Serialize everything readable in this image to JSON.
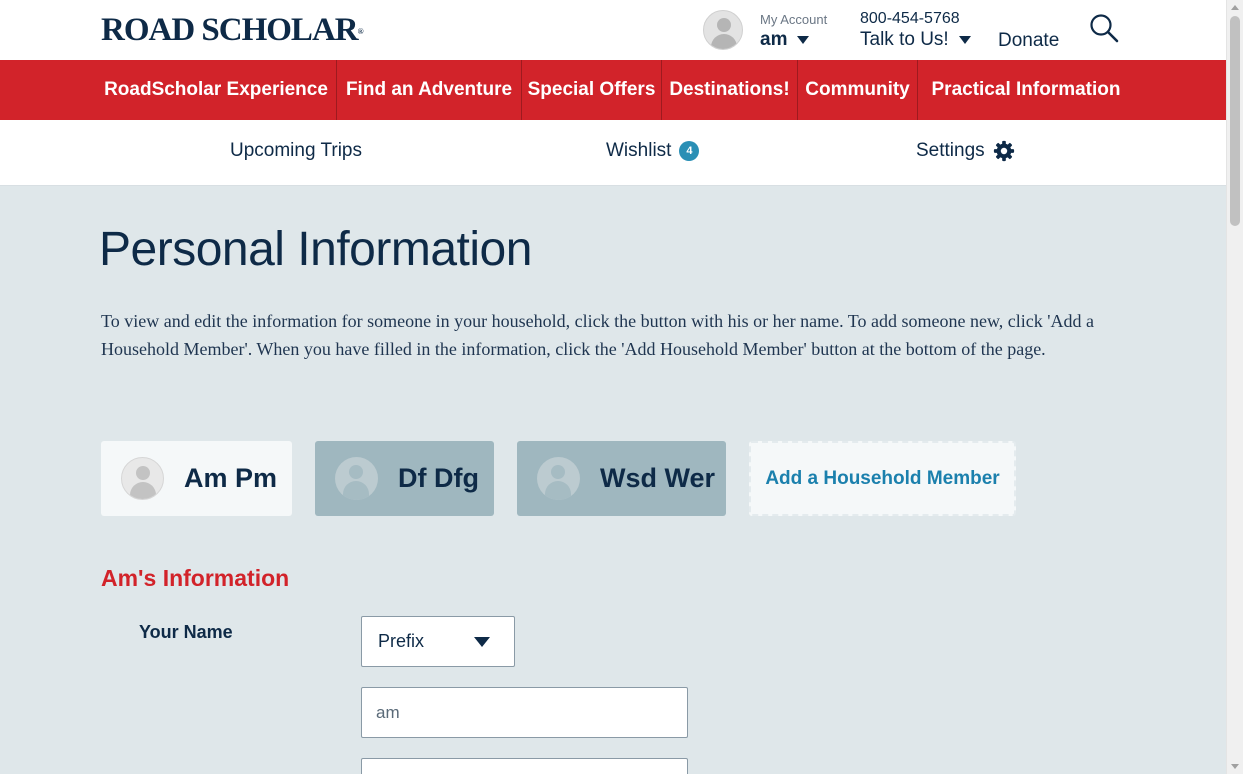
{
  "header": {
    "logo": "ROAD SCHOLAR",
    "logo_mark": "®",
    "account_small": "My Account",
    "account_name": "am",
    "phone": "800-454-5768",
    "talk_label": "Talk to Us!",
    "donate_label": "Donate"
  },
  "nav": {
    "items": [
      {
        "label": "RoadScholar Experience"
      },
      {
        "label": "Find an Adventure"
      },
      {
        "label": "Special Offers"
      },
      {
        "label": "Destinations!"
      },
      {
        "label": "Community"
      },
      {
        "label": "Practical Information"
      }
    ]
  },
  "subnav": {
    "upcoming_trips": "Upcoming Trips",
    "wishlist": "Wishlist",
    "wishlist_count": "4",
    "settings": "Settings"
  },
  "main": {
    "title": "Personal Information",
    "intro": "To view and edit the information for someone in your household, click the button with his or her name. To add someone new, click 'Add a Household Member'. When you have filled in the information, click the 'Add Household Member' button at the bottom of the page.",
    "members": [
      {
        "name": "Am Pm",
        "active": true
      },
      {
        "name": "Df Dfg",
        "active": false
      },
      {
        "name": "Wsd Wer",
        "active": false
      }
    ],
    "add_member_label": "Add a Household Member",
    "section_title": "Am's Information",
    "your_name_label": "Your Name",
    "prefix_value": "Prefix",
    "first_name_value": "am",
    "second_field_value": ""
  },
  "colors": {
    "brand_red": "#d2232a",
    "navy": "#0e2a47",
    "link_blue": "#1b80ad",
    "page_bg": "#dfe7ea"
  }
}
